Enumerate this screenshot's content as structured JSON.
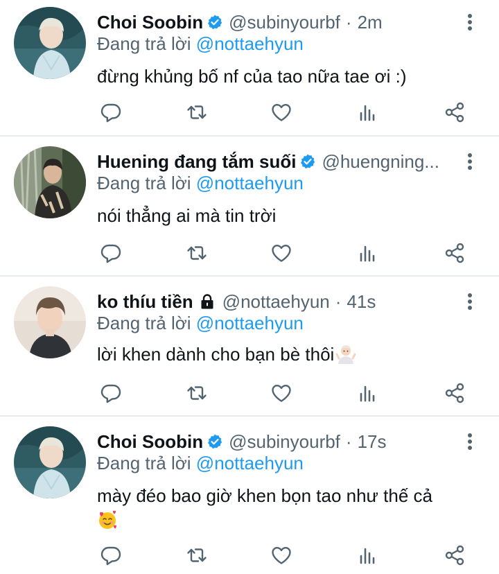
{
  "colors": {
    "mention": "#1d9bf0",
    "verified": "#1d9bf0",
    "secondary_text": "#536471",
    "divider": "#e8ecee"
  },
  "tweets": [
    {
      "name": "Choi Soobin",
      "verified": true,
      "handle": "@subinyourbf",
      "separator": "·",
      "time": "2m",
      "reply_prefix": "Đang trả lời",
      "reply_to": "@nottaehyun",
      "text": "đừng khủng bố nf của tao nữa tae ơi :)",
      "icons": [
        "reply-icon",
        "retweet-icon",
        "like-icon",
        "views-icon",
        "share-icon"
      ]
    },
    {
      "name": "Huening đang tắm suối",
      "verified": true,
      "handle": "@huengning...",
      "separator": "",
      "time": "",
      "reply_prefix": "Đang trả lời",
      "reply_to": "@nottaehyun",
      "text": "nói thẳng ai mà tin trời",
      "icons": [
        "reply-icon",
        "retweet-icon",
        "like-icon",
        "views-icon",
        "share-icon"
      ]
    },
    {
      "name": "ko thíu tiền",
      "verified": false,
      "locked": true,
      "handle": "@nottaehyun",
      "separator": "·",
      "time": "41s",
      "reply_prefix": "Đang trả lời",
      "reply_to": "@nottaehyun",
      "text": "lời khen dành cho bạn bè thôi",
      "emoji": "person-shrugging-emoji",
      "icons": [
        "reply-icon",
        "retweet-icon",
        "like-icon",
        "views-icon",
        "share-icon"
      ]
    },
    {
      "name": "Choi Soobin",
      "verified": true,
      "handle": "@subinyourbf",
      "separator": "·",
      "time": "17s",
      "reply_prefix": "Đang trả lời",
      "reply_to": "@nottaehyun",
      "text": "mày đéo bao giờ khen bọn tao như thế cả",
      "emoji": "smiling-face-with-hearts-emoji",
      "icons": [
        "reply-icon",
        "retweet-icon",
        "like-icon",
        "views-icon",
        "share-icon"
      ]
    }
  ]
}
